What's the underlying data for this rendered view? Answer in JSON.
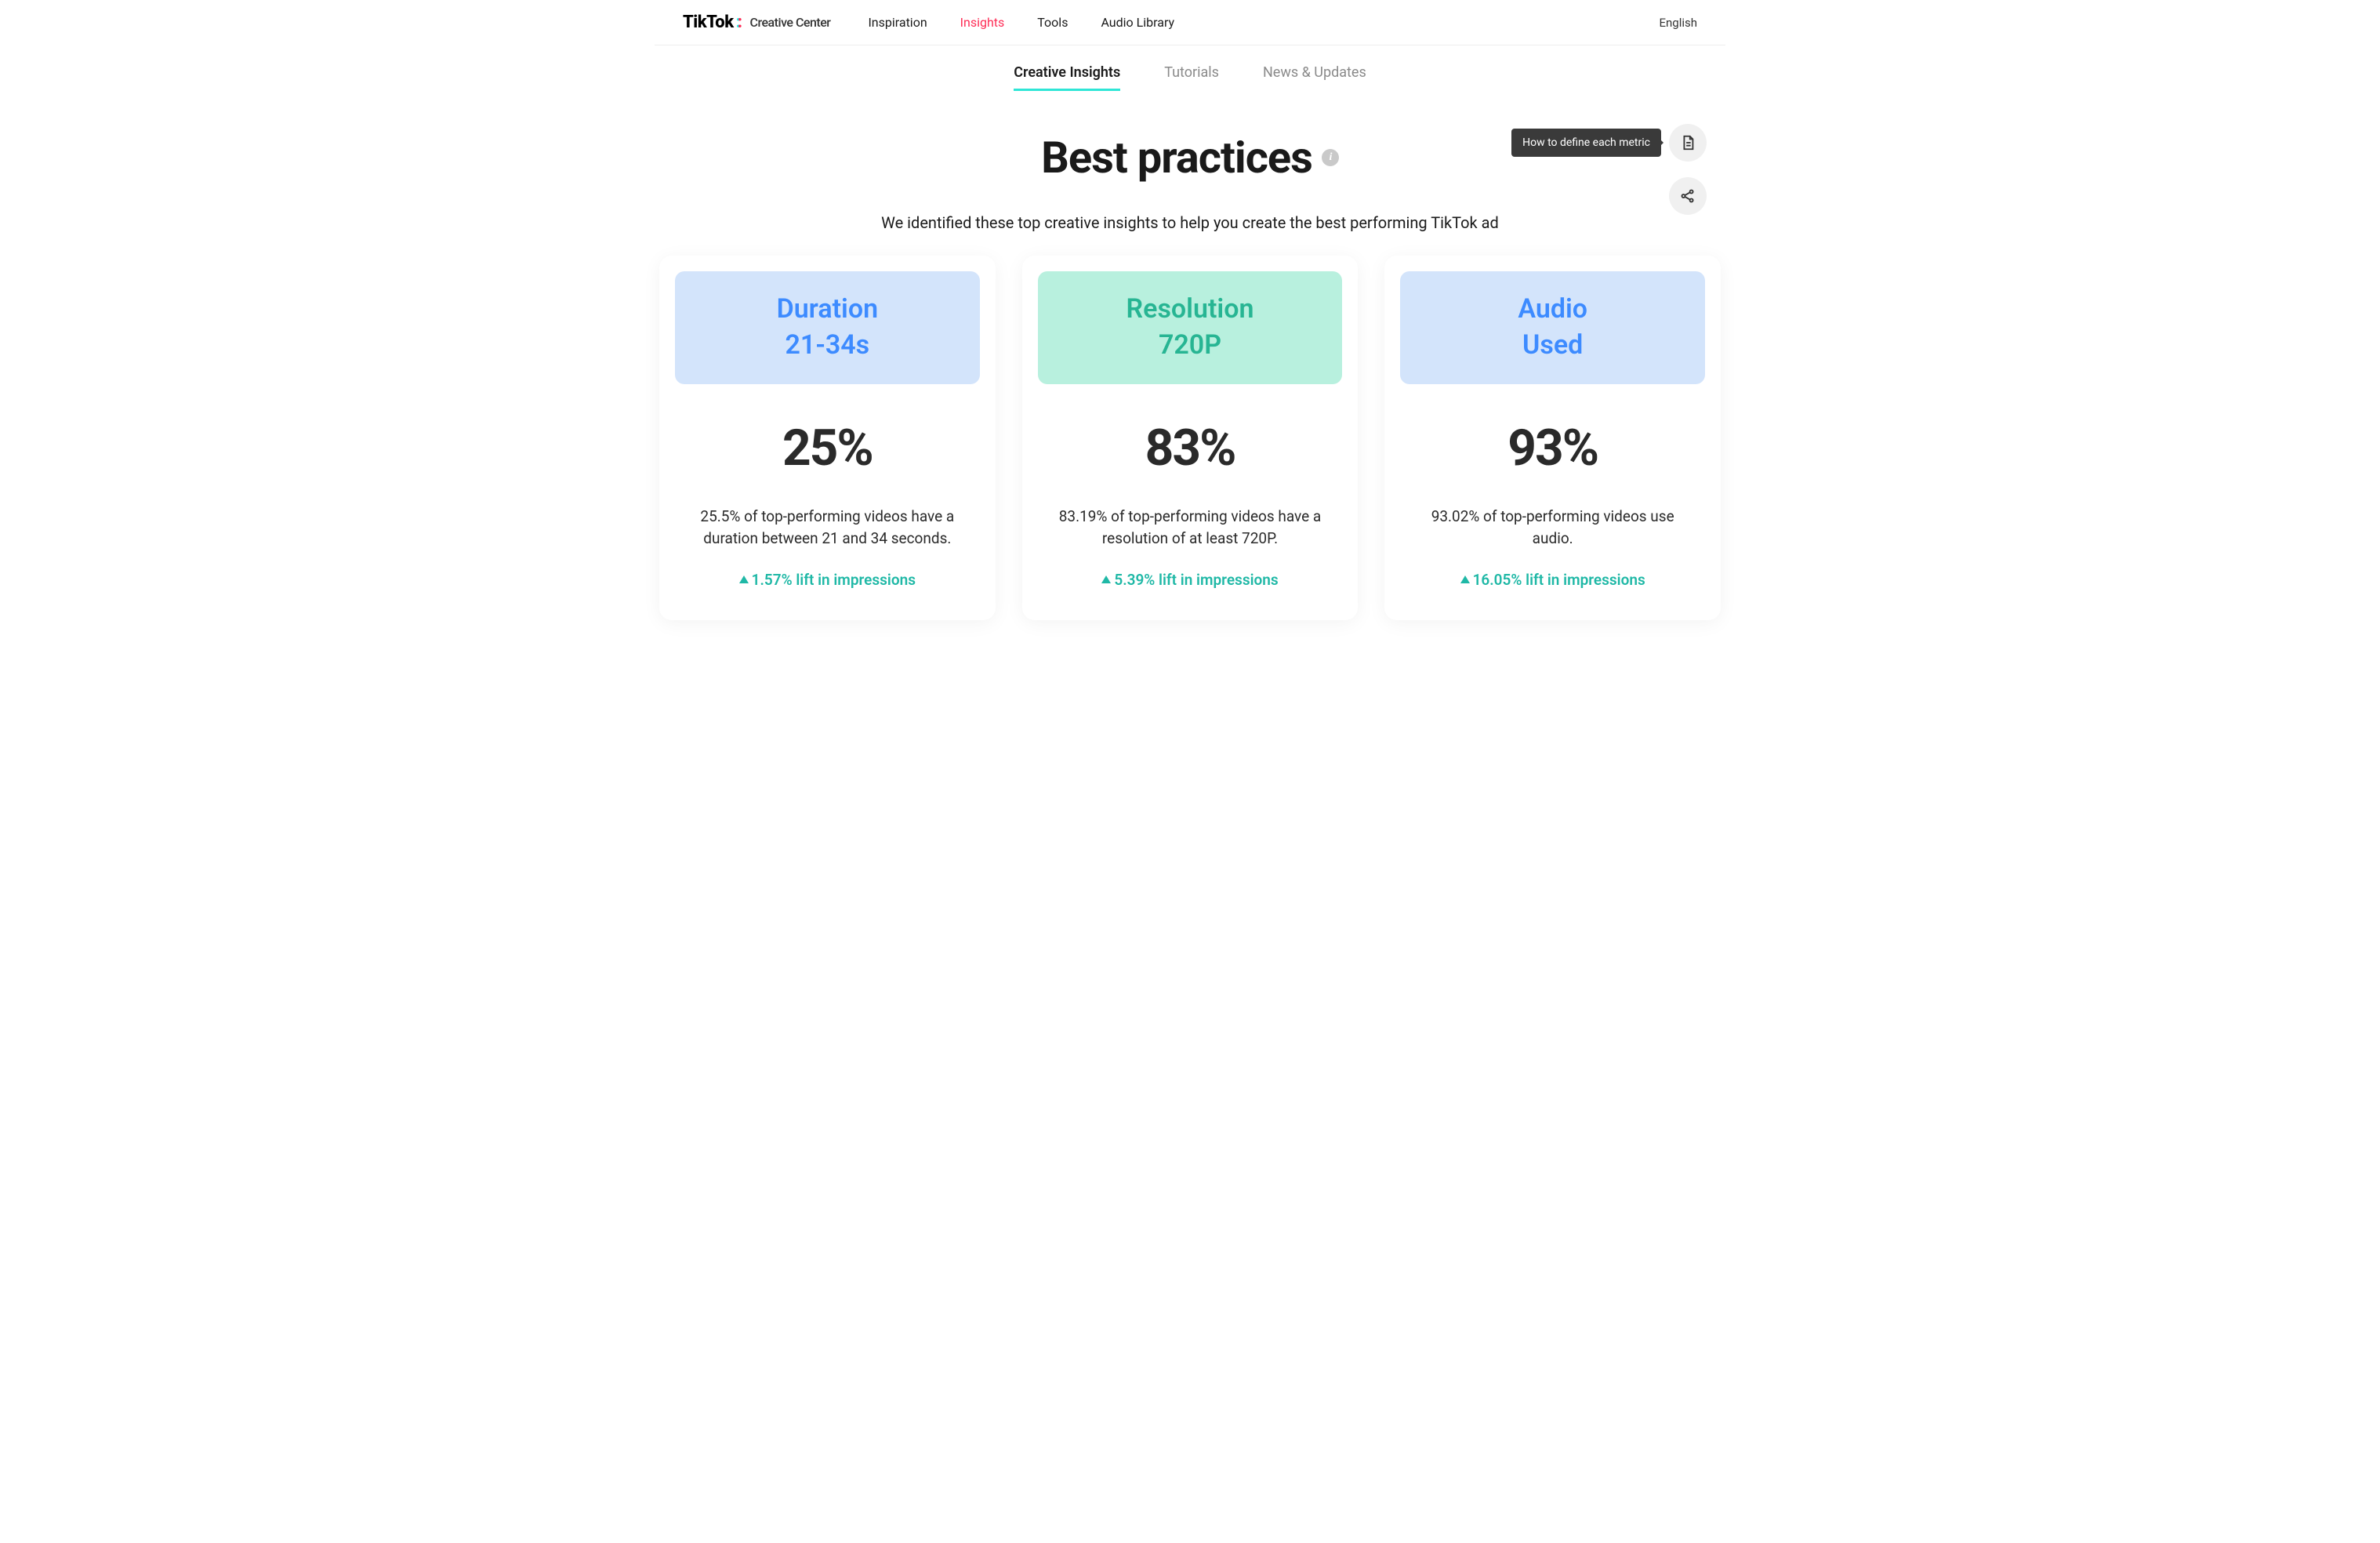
{
  "header": {
    "logo_main": "TikTok",
    "logo_sub": "Creative Center",
    "nav": [
      "Inspiration",
      "Insights",
      "Tools",
      "Audio Library"
    ],
    "nav_active_index": 1,
    "language": "English"
  },
  "subtabs": {
    "items": [
      "Creative Insights",
      "Tutorials",
      "News & Updates"
    ],
    "active_index": 0
  },
  "hero": {
    "title": "Best practices",
    "subtitle": "We identified these top creative insights to help you create the best performing TikTok ad",
    "tooltip": "How to define each metric"
  },
  "cards": [
    {
      "head_title": "Duration",
      "head_sub": "21-34s",
      "variant": "blue",
      "big": "25%",
      "desc": "25.5% of top-performing videos have a duration between 21 and 34 seconds.",
      "lift": "1.57% lift in impressions"
    },
    {
      "head_title": "Resolution",
      "head_sub": "720P",
      "variant": "mint",
      "big": "83%",
      "desc": "83.19% of top-performing videos have a resolution of at least 720P.",
      "lift": "5.39% lift in impressions"
    },
    {
      "head_title": "Audio",
      "head_sub": "Used",
      "variant": "blue",
      "big": "93%",
      "desc": "93.02% of top-performing videos use audio.",
      "lift": "16.05% lift in impressions"
    }
  ]
}
